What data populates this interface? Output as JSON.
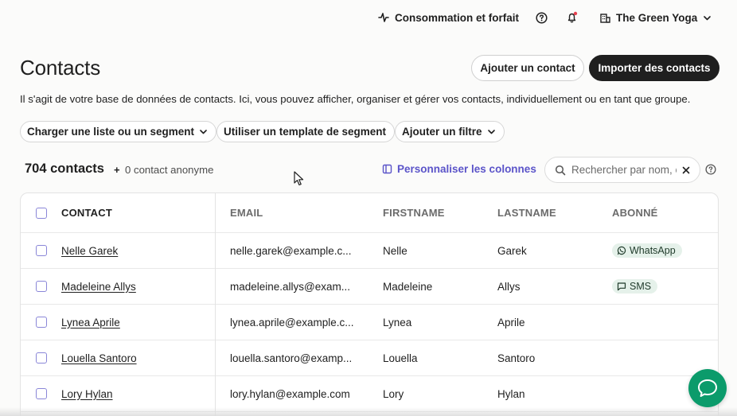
{
  "topbar": {
    "usage_label": "Consommation et forfait",
    "account_name": "The Green Yoga"
  },
  "header": {
    "title": "Contacts",
    "add_contact_label": "Ajouter un contact",
    "import_label": "Importer des contacts",
    "description": "Il s'agit de votre base de données de contacts. Ici, vous pouvez afficher, organiser et gérer vos contacts, individuellement ou en tant que groupe."
  },
  "filters": {
    "load_list_label": "Charger une liste ou un segment",
    "segment_template_label": "Utiliser un template de segment",
    "add_filter_label": "Ajouter un filtre"
  },
  "summary": {
    "count": "704 contacts",
    "plus": "+",
    "anonymous": "0 contact anonyme",
    "customize_label": "Personnaliser les colonnes"
  },
  "search": {
    "placeholder": "Rechercher par nom, e-mail"
  },
  "table": {
    "columns": [
      "CONTACT",
      "EMAIL",
      "FIRSTNAME",
      "LASTNAME",
      "ABONNÉ"
    ],
    "rows": [
      {
        "contact": "Nelle Garek",
        "email": "nelle.garek@example.c...",
        "firstname": "Nelle",
        "lastname": "Garek",
        "subscribed": "WhatsApp"
      },
      {
        "contact": "Madeleine Allys",
        "email": "madeleine.allys@exam...",
        "firstname": "Madeleine",
        "lastname": "Allys",
        "subscribed": "SMS"
      },
      {
        "contact": "Lynea Aprile",
        "email": "lynea.aprile@example.c...",
        "firstname": "Lynea",
        "lastname": "Aprile",
        "subscribed": ""
      },
      {
        "contact": "Louella Santoro",
        "email": "louella.santoro@examp...",
        "firstname": "Louella",
        "lastname": "Santoro",
        "subscribed": ""
      },
      {
        "contact": "Lory Hylan",
        "email": "lory.hylan@example.com",
        "firstname": "Lory",
        "lastname": "Hylan",
        "subscribed": ""
      }
    ]
  },
  "colors": {
    "accent": "#5b54c9",
    "dark_button": "#1f1f1f",
    "badge_bg": "#e5f1ea",
    "chat_bubble": "#0b9b6b"
  }
}
